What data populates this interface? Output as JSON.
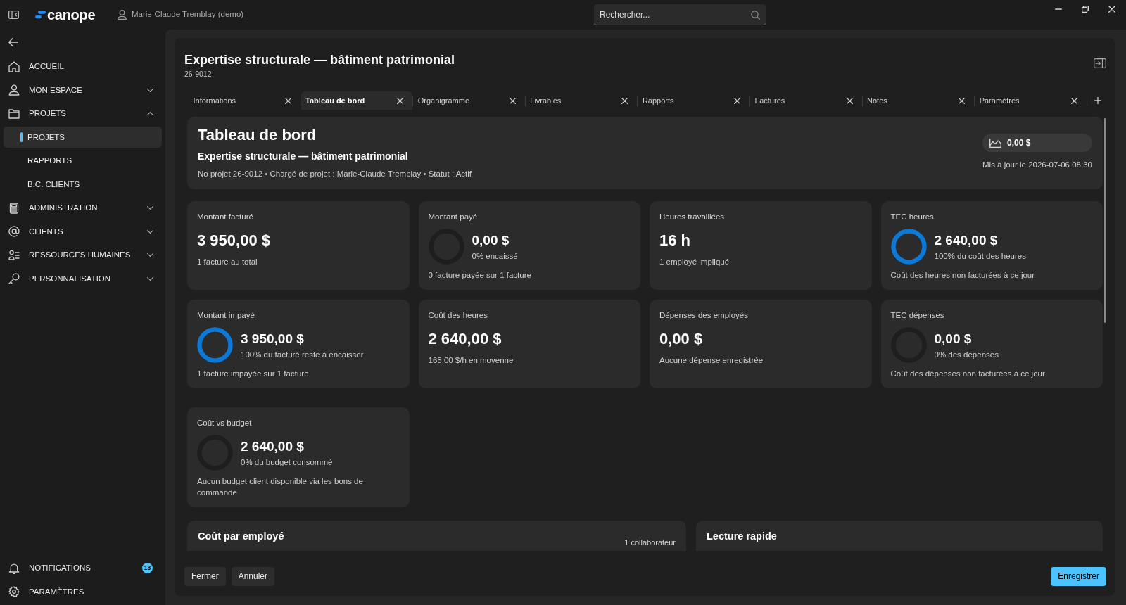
{
  "title_bar": {
    "logo": "canope",
    "user": "Marie-Claude Tremblay (demo)",
    "search": {
      "placeholder": "Rechercher..."
    }
  },
  "sidebar": {
    "items": [
      {
        "label": "ACCUEIL",
        "kind": "link",
        "selected": false
      },
      {
        "label": "MON ESPACE",
        "kind": "group",
        "selected": false,
        "expanded": false
      },
      {
        "label": "PROJETS",
        "kind": "group",
        "selected": false,
        "expanded": true,
        "children": [
          {
            "label": "PROJETS",
            "selected": true
          },
          {
            "label": "RAPPORTS",
            "selected": false
          },
          {
            "label": "B.C. CLIENTS",
            "selected": false
          }
        ]
      },
      {
        "label": "ADMINISTRATION",
        "kind": "group",
        "selected": false,
        "expanded": false
      },
      {
        "label": "CLIENTS",
        "kind": "group",
        "selected": false,
        "expanded": false
      },
      {
        "label": "RESSOURCES HUMAINES",
        "kind": "group",
        "selected": false,
        "expanded": false
      },
      {
        "label": "PERSONNALISATION",
        "kind": "group",
        "selected": false,
        "expanded": false
      }
    ],
    "bottom_items": [
      {
        "label": "NOTIFICATIONS",
        "badge": "13"
      },
      {
        "label": "PARAMÈTRES"
      }
    ]
  },
  "project": {
    "title": "Expertise structurale — bâtiment patrimonial",
    "code": "26-9012"
  },
  "tabs": [
    {
      "label": "Informations",
      "selected": false
    },
    {
      "label": "Tableau de bord",
      "selected": true
    },
    {
      "label": "Organigramme",
      "selected": false
    },
    {
      "label": "Livrables",
      "selected": false
    },
    {
      "label": "Rapports",
      "selected": false
    },
    {
      "label": "Factures",
      "selected": false
    },
    {
      "label": "Notes",
      "selected": false
    },
    {
      "label": "Paramètres",
      "selected": false
    }
  ],
  "dashboard": {
    "title": "Tableau de bord",
    "subtitle": "Expertise structurale — bâtiment patrimonial",
    "meta": "No projet 26-9012 • Chargé de projet : Marie-Claude Tremblay • Statut : Actif",
    "total": "0,00 $",
    "updated": "Mis à jour le 2026-07-06 08:30",
    "kpi_groups": [
      {
        "cards": [
          {
            "kind": "stat",
            "label": "Montant facturé",
            "value": "3 950,00 $",
            "footer": "1 facture au total"
          },
          {
            "kind": "ring",
            "label": "Montant payé",
            "level": 0,
            "value": "0,00 $",
            "note": "0% encaissé",
            "footer": "0 facture payée sur 1 facture"
          },
          {
            "kind": "stat",
            "label": "Heures travaillées",
            "value": "16 h",
            "footer": "1 employé impliqué"
          },
          {
            "kind": "ring",
            "label": "TEC heures",
            "level": 1,
            "value": "2 640,00 $",
            "note": "100% du coût des heures",
            "footer": "Coût des heures non facturées à ce jour"
          },
          {
            "kind": "ring",
            "label": "Montant impayé",
            "level": 1,
            "value": "3 950,00 $",
            "note": "100% du facturé reste à encaisser",
            "footer": "1 facture impayée sur 1 facture"
          },
          {
            "kind": "stat",
            "label": "Coût des heures",
            "value": "2 640,00 $",
            "footer": "165,00 $/h en moyenne"
          },
          {
            "kind": "stat",
            "label": "Dépenses des employés",
            "value": "0,00 $",
            "footer": "Aucune dépense enregistrée"
          },
          {
            "kind": "ring",
            "label": "TEC dépenses",
            "level": 0,
            "value": "0,00 $",
            "note": "0% des dépenses",
            "footer": "Coût des dépenses non facturées à ce jour"
          }
        ]
      },
      {
        "cards": [
          {
            "kind": "ring",
            "label": "Coût vs budget",
            "level": 0,
            "value": "2 640,00 $",
            "note": "0% du budget consommé",
            "footer": "Aucun budget client disponible via les bons de commande"
          }
        ]
      }
    ],
    "sections": [
      {
        "title": "Coût par employé",
        "count": "1 collaborateur"
      },
      {
        "title": "Lecture rapide"
      }
    ]
  },
  "footer": {
    "buttons": [
      {
        "label": "Fermer",
        "kind": "secondary"
      },
      {
        "label": "Annuler",
        "kind": "secondary"
      },
      {
        "label": "Enregistrer",
        "kind": "primary"
      }
    ]
  }
}
